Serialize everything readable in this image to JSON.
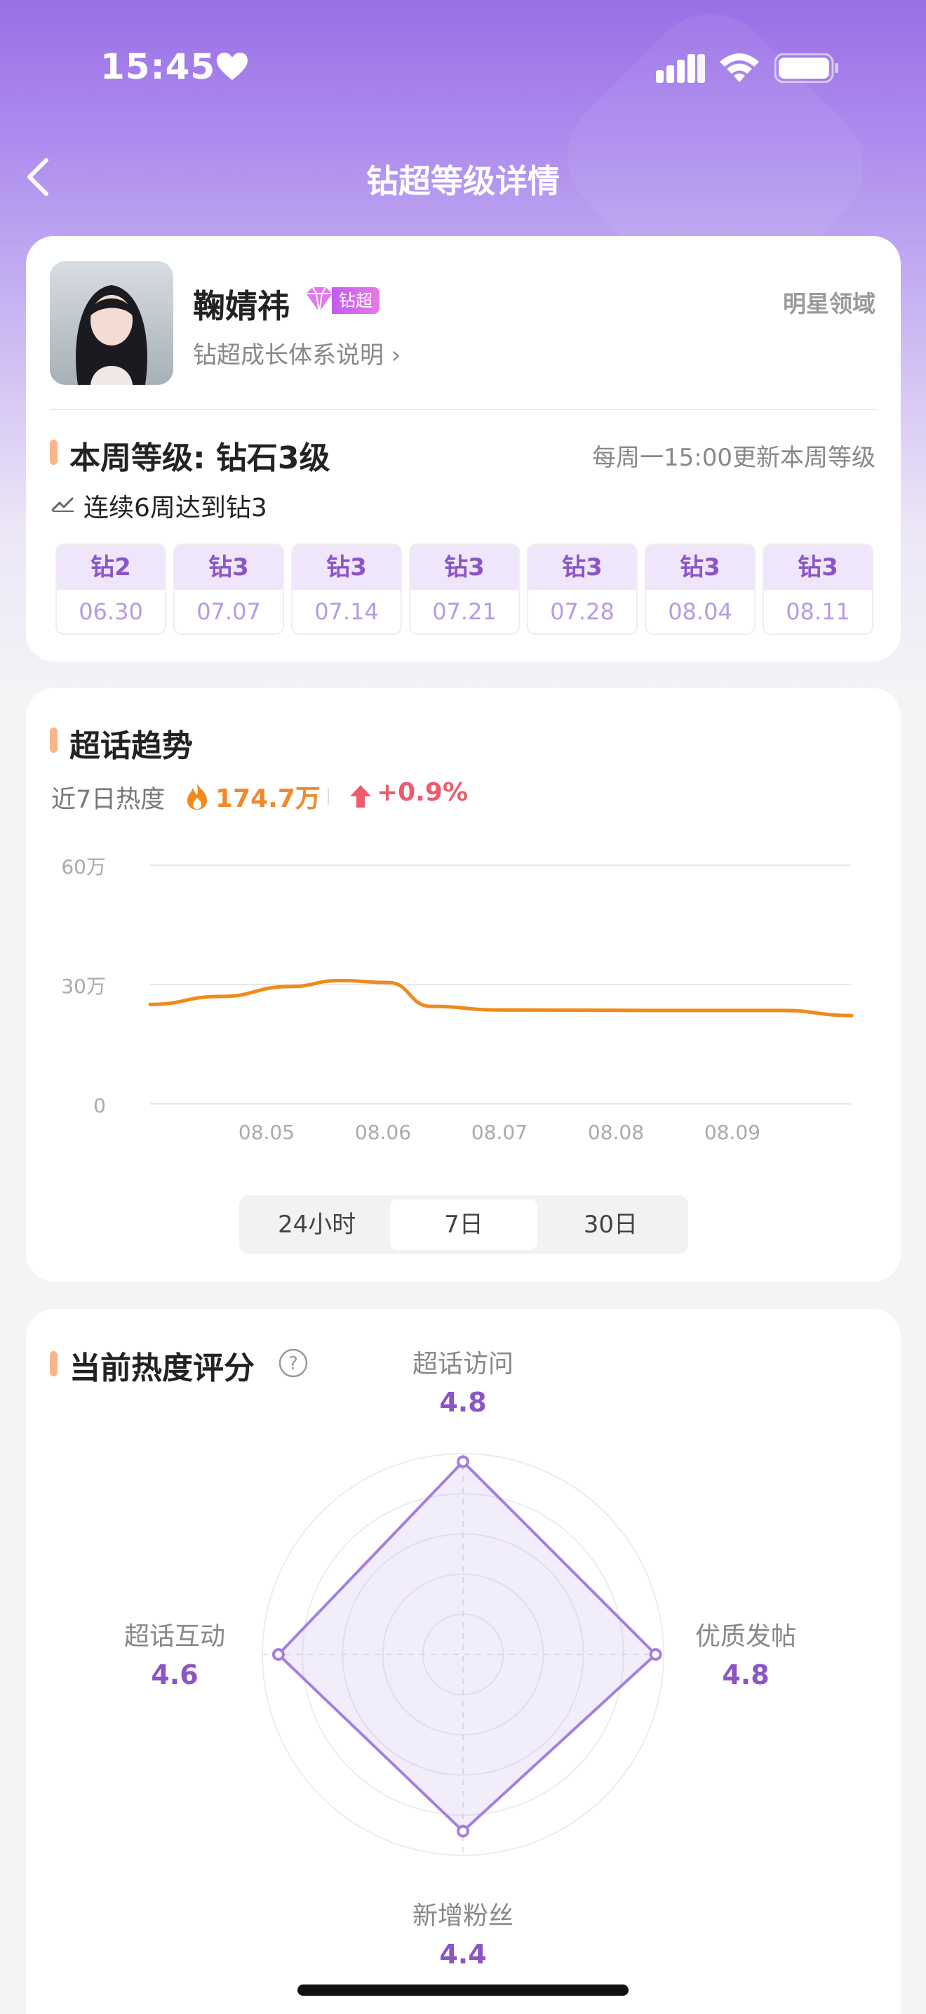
{
  "status_bar": {
    "time": "15:45"
  },
  "nav": {
    "title": "钻超等级详情"
  },
  "profile": {
    "name": "鞠婧祎",
    "badge_label": "钻超",
    "growth_link": "钻超成长体系说明 ›",
    "domain_tag": "明星领域"
  },
  "level": {
    "current": "本周等级: 钻石3级",
    "update_note": "每周一15:00更新本周等级",
    "streak": "连续6周达到钻3",
    "weeks": [
      {
        "level": "钻2",
        "date": "06.30"
      },
      {
        "level": "钻3",
        "date": "07.07"
      },
      {
        "level": "钻3",
        "date": "07.14"
      },
      {
        "level": "钻3",
        "date": "07.21"
      },
      {
        "level": "钻3",
        "date": "07.28"
      },
      {
        "level": "钻3",
        "date": "08.04"
      },
      {
        "level": "钻3",
        "date": "08.11"
      }
    ]
  },
  "trend": {
    "title": "超话趋势",
    "heat_label": "近7日热度",
    "heat_value": "174.7万",
    "change": "+0.9%",
    "tabs": [
      "24小时",
      "7日",
      "30日"
    ],
    "active_tab": 1
  },
  "chart_data": {
    "type": "line",
    "x": [
      "08.05",
      "08.06",
      "08.07",
      "08.08",
      "08.09"
    ],
    "ytick_labels": [
      "0",
      "30万",
      "60万"
    ],
    "ylim": [
      0,
      60
    ],
    "y_unit": "万",
    "series": [
      {
        "color": "#f08a1c",
        "points": [
          {
            "x": 0.0,
            "y": 25
          },
          {
            "x": 0.5,
            "y": 27
          },
          {
            "x": 1.0,
            "y": 29.5
          },
          {
            "x": 1.35,
            "y": 31
          },
          {
            "x": 1.7,
            "y": 30.5
          },
          {
            "x": 2.0,
            "y": 24.5
          },
          {
            "x": 2.5,
            "y": 23.6
          },
          {
            "x": 3.5,
            "y": 23.5
          },
          {
            "x": 4.5,
            "y": 23.5
          },
          {
            "x": 5.0,
            "y": 22.2
          }
        ]
      }
    ],
    "grid": true
  },
  "score": {
    "title": "当前热度评分",
    "axes": [
      {
        "label": "超话访问",
        "value": 4.8
      },
      {
        "label": "优质发帖",
        "value": 4.8
      },
      {
        "label": "新增粉丝",
        "value": 4.4
      },
      {
        "label": "超话互动",
        "value": 4.6
      }
    ],
    "max": 5
  },
  "colors": {
    "accent_purple": "#8b55c8",
    "heat_orange": "#f08a1c",
    "change_red": "#ef5b6e",
    "radar_stroke": "#a57ee0"
  }
}
